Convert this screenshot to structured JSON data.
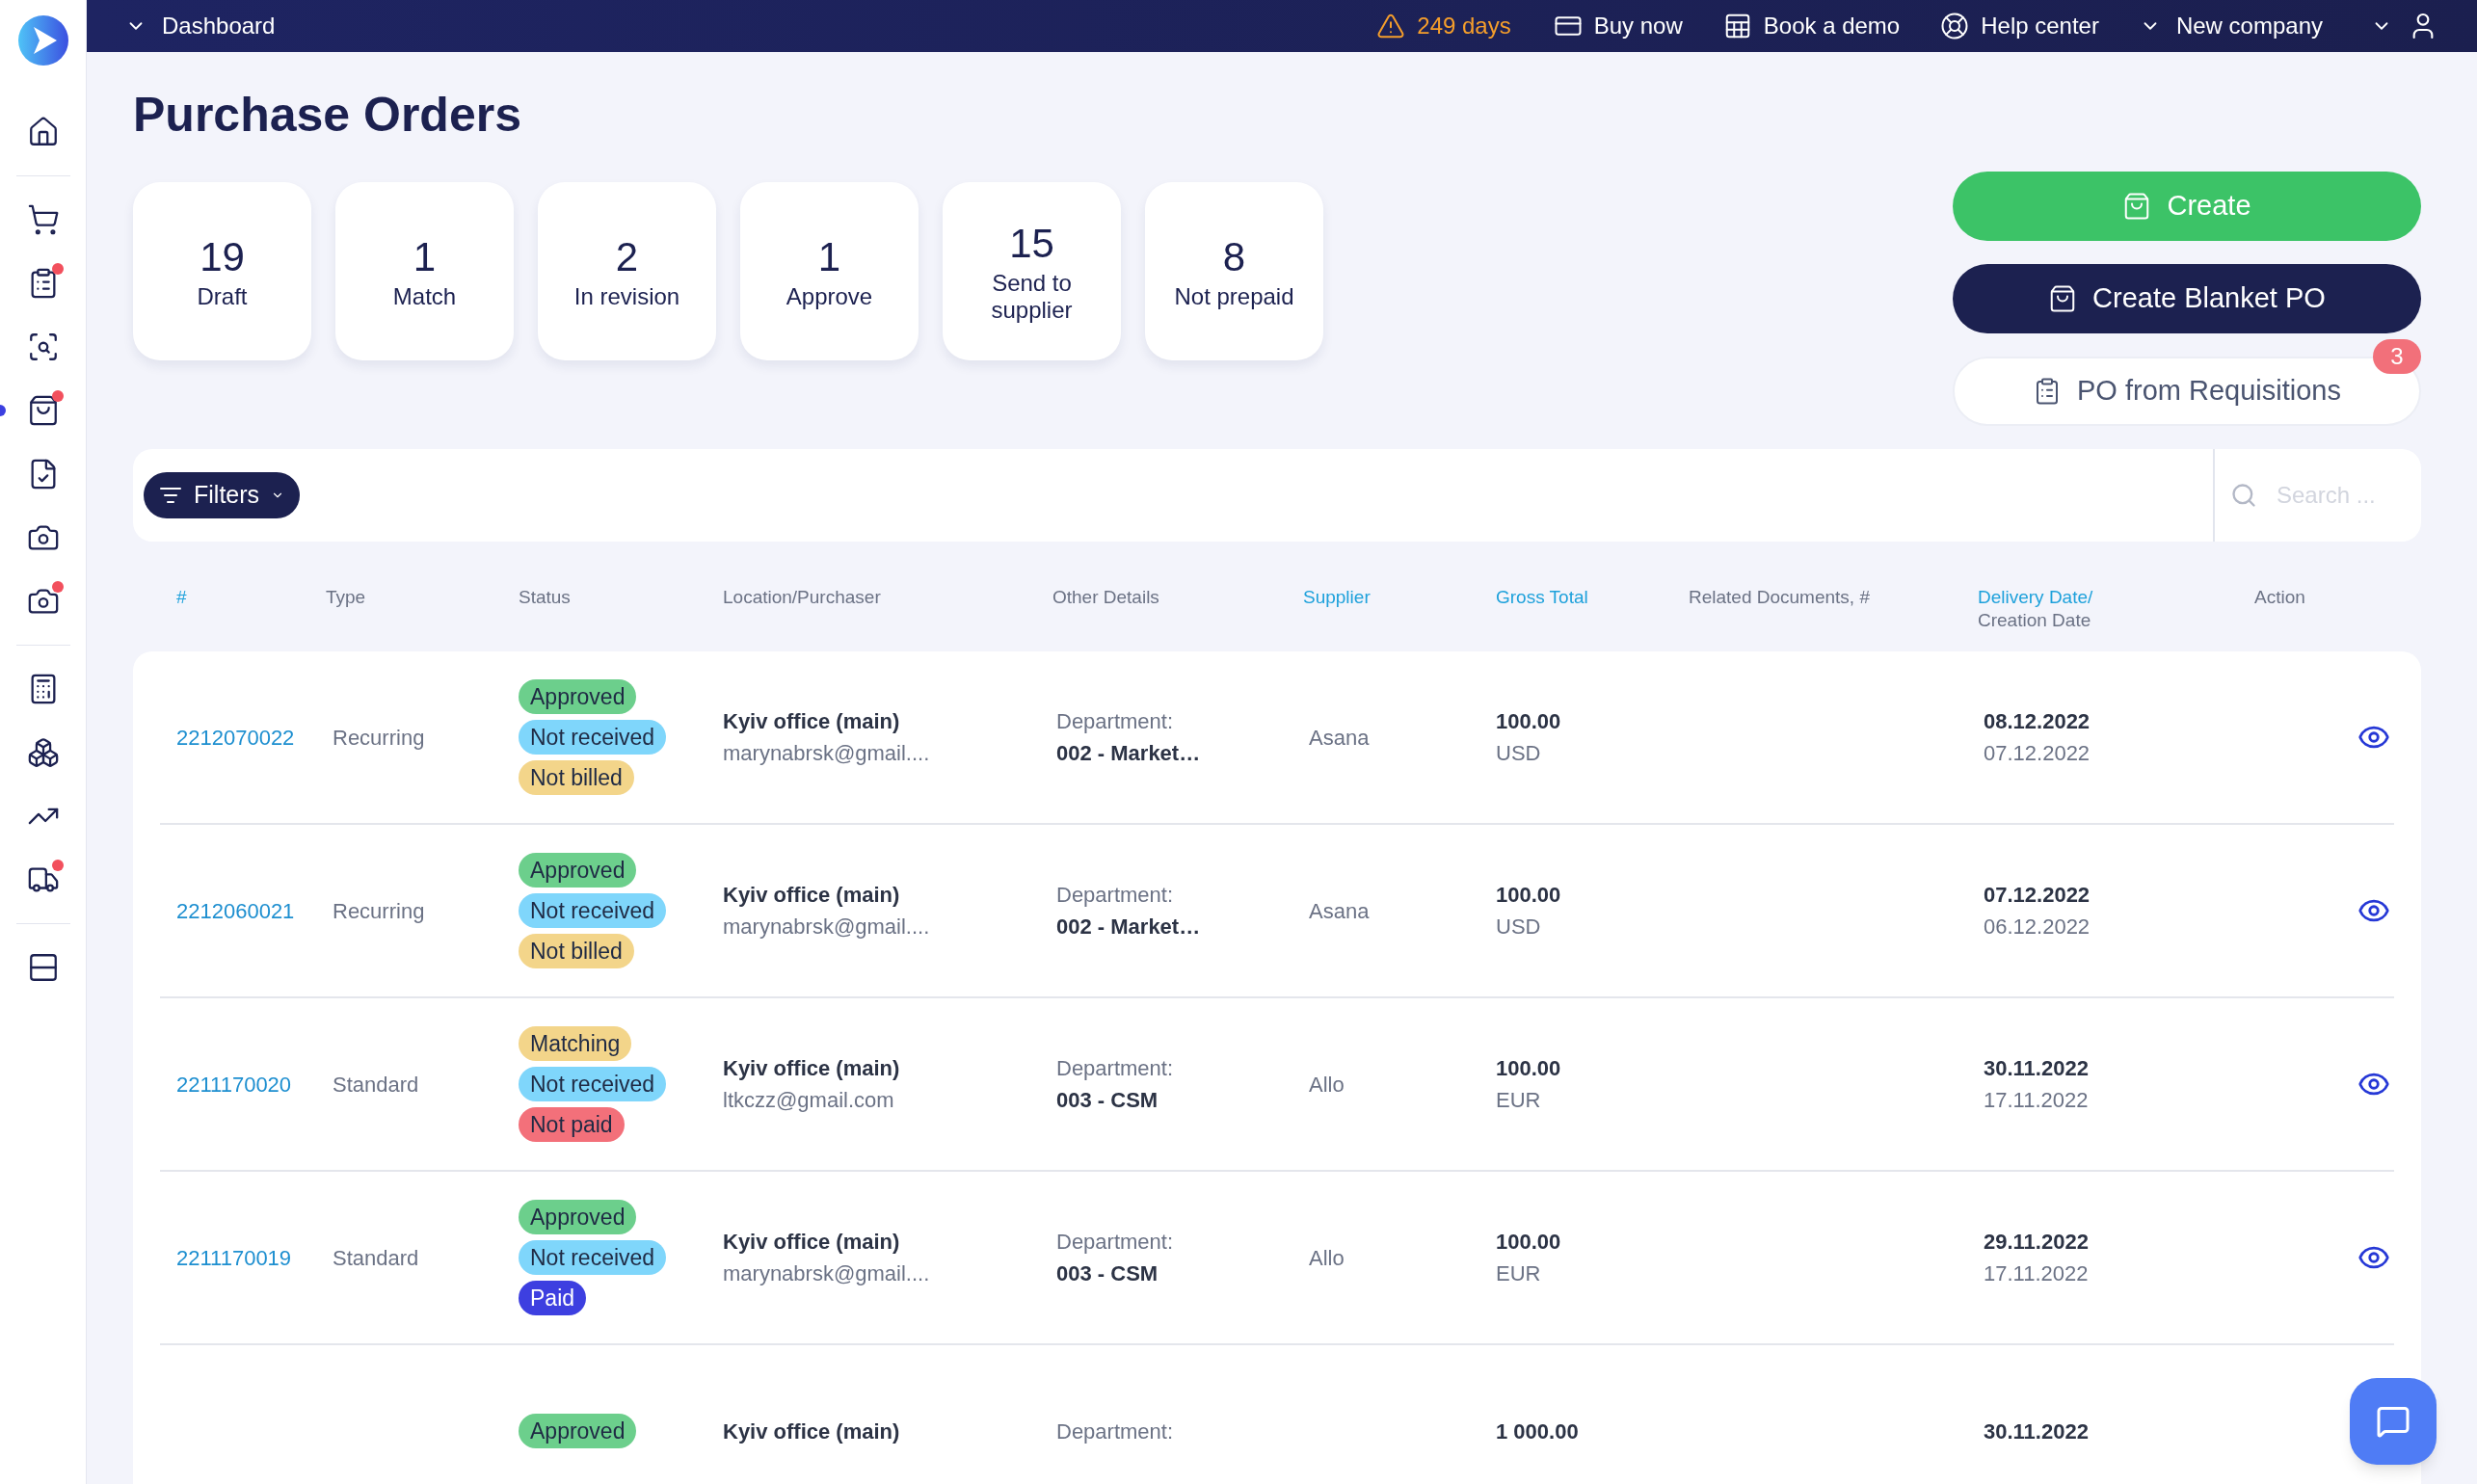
{
  "sidebar": {
    "groups": [
      [
        {
          "alert": false,
          "selected": false
        }
      ],
      [
        {
          "alert": false,
          "selected": false
        },
        {
          "alert": true,
          "selected": false
        },
        {
          "alert": false,
          "selected": false
        },
        {
          "alert": true,
          "selected": true
        },
        {
          "alert": false,
          "selected": false
        },
        {
          "alert": false,
          "selected": false
        },
        {
          "alert": true,
          "selected": false
        }
      ],
      [
        {
          "alert": false,
          "selected": false
        },
        {
          "alert": false,
          "selected": false
        },
        {
          "alert": false,
          "selected": false
        },
        {
          "alert": true,
          "selected": false
        }
      ],
      [
        {
          "alert": false,
          "selected": false
        }
      ]
    ]
  },
  "topbar": {
    "breadcrumb": "Dashboard",
    "trial": "249 days",
    "links": [
      "Buy now",
      "Book a demo",
      "Help center"
    ],
    "company": "New company"
  },
  "title": "Purchase Orders",
  "stats": [
    {
      "count": "19",
      "label": "Draft"
    },
    {
      "count": "1",
      "label": "Match"
    },
    {
      "count": "2",
      "label": "In revision"
    },
    {
      "count": "1",
      "label": "Approve"
    },
    {
      "count": "15",
      "label": "Send to supplier"
    },
    {
      "count": "8",
      "label": "Not prepaid"
    }
  ],
  "actions": [
    {
      "kind": "primary",
      "label": "Create"
    },
    {
      "kind": "dark",
      "label": "Create Blanket PO"
    },
    {
      "kind": "outline",
      "label": "PO from Requisitions",
      "badge": "3"
    }
  ],
  "filters": {
    "label": "Filters",
    "search_placeholder": "Search ..."
  },
  "table": {
    "columns": [
      {
        "label": "#",
        "sortable": true
      },
      {
        "label": "Type",
        "sortable": false
      },
      {
        "label": "Status",
        "sortable": false
      },
      {
        "label": "Location/Purchaser",
        "sortable": false
      },
      {
        "label": "Other Details",
        "sortable": false
      },
      {
        "label": "Supplier",
        "sortable": true
      },
      {
        "label": "Gross Total",
        "sortable": true
      },
      {
        "label": "Related Documents, #",
        "sortable": false
      },
      {
        "label": "Delivery Date/",
        "sub": "Creation Date",
        "sortable": true
      },
      {
        "label": "Action",
        "sortable": false
      }
    ],
    "rows": [
      {
        "number": "2212070022",
        "type": "Recurring",
        "statuses": [
          {
            "label": "Approved",
            "color": "#6ccf8c"
          },
          {
            "label": "Not received",
            "color": "#7fd6fb"
          },
          {
            "label": "Not billed",
            "color": "#f3d58a"
          }
        ],
        "location": "Kyiv office (main)",
        "purchaser": "marynabrsk@gmail....",
        "detail_label": "Department:",
        "detail_value": "002 - Market…",
        "supplier": "Asana",
        "amount": "100.00",
        "currency": "USD",
        "delivery": "08.12.2022",
        "created": "07.12.2022"
      },
      {
        "number": "2212060021",
        "type": "Recurring",
        "statuses": [
          {
            "label": "Approved",
            "color": "#6ccf8c"
          },
          {
            "label": "Not received",
            "color": "#7fd6fb"
          },
          {
            "label": "Not billed",
            "color": "#f3d58a"
          }
        ],
        "location": "Kyiv office (main)",
        "purchaser": "marynabrsk@gmail....",
        "detail_label": "Department:",
        "detail_value": "002 - Market…",
        "supplier": "Asana",
        "amount": "100.00",
        "currency": "USD",
        "delivery": "07.12.2022",
        "created": "06.12.2022"
      },
      {
        "number": "2211170020",
        "type": "Standard",
        "statuses": [
          {
            "label": "Matching",
            "color": "#f3d58a"
          },
          {
            "label": "Not received",
            "color": "#7fd6fb"
          },
          {
            "label": "Not paid",
            "color": "#f3707a"
          }
        ],
        "location": "Kyiv office (main)",
        "purchaser": "ltkczz@gmail.com",
        "detail_label": "Department:",
        "detail_value": "003 - CSM",
        "supplier": "Allo",
        "amount": "100.00",
        "currency": "EUR",
        "delivery": "30.11.2022",
        "created": "17.11.2022"
      },
      {
        "number": "2211170019",
        "type": "Standard",
        "statuses": [
          {
            "label": "Approved",
            "color": "#6ccf8c"
          },
          {
            "label": "Not received",
            "color": "#7fd6fb"
          },
          {
            "label": "Paid",
            "color": "#3d3fe0"
          }
        ],
        "location": "Kyiv office (main)",
        "purchaser": "marynabrsk@gmail....",
        "detail_label": "Department:",
        "detail_value": "003 - CSM",
        "supplier": "Allo",
        "amount": "100.00",
        "currency": "EUR",
        "delivery": "29.11.2022",
        "created": "17.11.2022"
      },
      {
        "statuses": [
          {
            "label": "Approved",
            "color": "#6ccf8c"
          }
        ],
        "location": "Kyiv office (main)",
        "detail_label": "Department:",
        "amount": "1 000.00",
        "delivery": "30.11.2022"
      }
    ]
  }
}
